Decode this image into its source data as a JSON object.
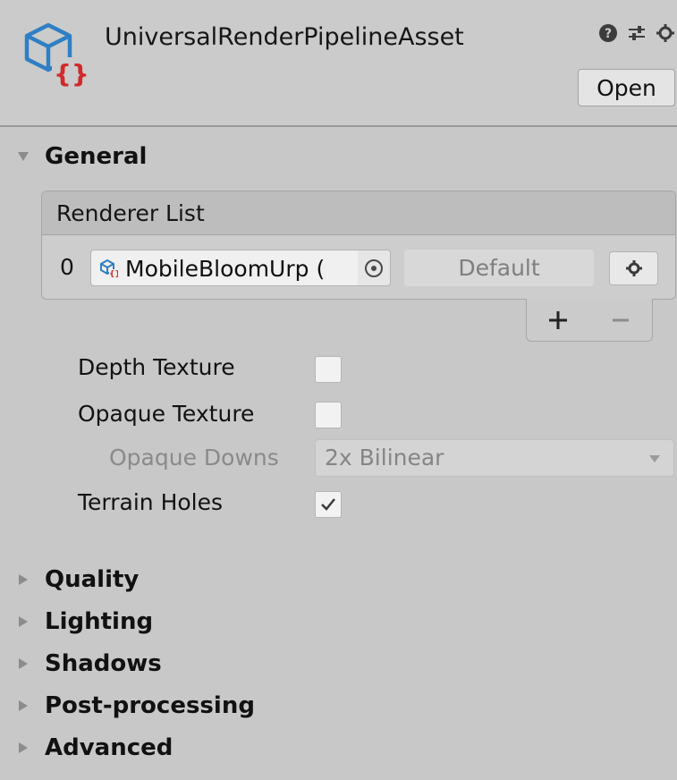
{
  "header": {
    "title": "UniversalRenderPipelineAsset",
    "open_label": "Open",
    "icons": [
      "help-icon",
      "presets-icon",
      "settings-icon"
    ]
  },
  "sections": {
    "general": "General",
    "quality": "Quality",
    "lighting": "Lighting",
    "shadows": "Shadows",
    "post_processing": "Post-processing",
    "advanced": "Advanced"
  },
  "general": {
    "renderer_list": {
      "title": "Renderer List",
      "rows": [
        {
          "index": "0",
          "object": "MobileBloomUrp (",
          "default_label": "Default"
        }
      ],
      "add_label": "+",
      "remove_label": "−"
    },
    "depth_texture": {
      "label": "Depth Texture",
      "checked": false
    },
    "opaque_texture": {
      "label": "Opaque Texture",
      "checked": false
    },
    "opaque_downsampling": {
      "label": "Opaque Downs",
      "value": "2x Bilinear",
      "enabled": false
    },
    "terrain_holes": {
      "label": "Terrain Holes",
      "checked": true
    }
  },
  "colors": {
    "panel_bg": "#c8c8c8",
    "asset_icon_blue": "#2f7fc4",
    "asset_icon_red": "#d12a2a"
  }
}
